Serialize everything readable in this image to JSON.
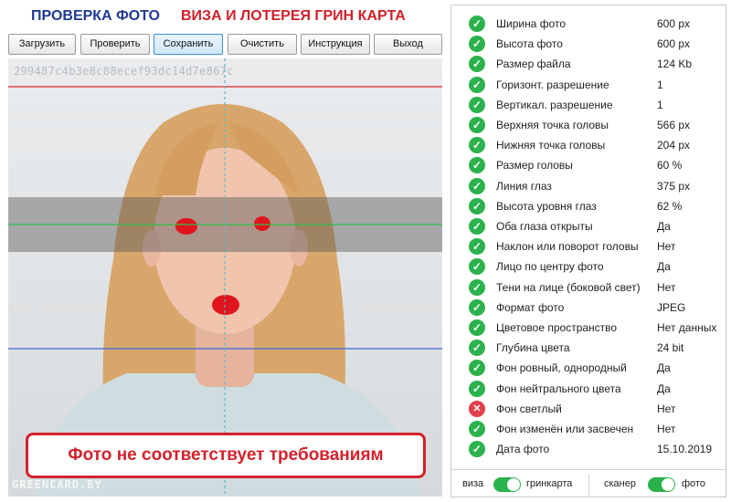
{
  "header": {
    "title_left": "ПРОВЕРКА ФОТО",
    "title_right": "ВИЗА И ЛОТЕРЕЯ ГРИН КАРТА"
  },
  "toolbar": {
    "buttons": [
      {
        "label": "Загрузить"
      },
      {
        "label": "Проверить"
      },
      {
        "label": "Сохранить",
        "active": true
      },
      {
        "label": "Очистить"
      },
      {
        "label": "Инструкция"
      },
      {
        "label": "Выход"
      }
    ]
  },
  "photo": {
    "hash": "299487c4b3e8c88ecef93dc14d7e867c",
    "watermark": "GREENCARD.BY",
    "warning": "Фото не соответствует требованиям"
  },
  "checks": [
    {
      "label": "Ширина фото",
      "value": "600 px",
      "status": "ok"
    },
    {
      "label": "Высота фото",
      "value": "600 px",
      "status": "ok"
    },
    {
      "label": "Размер файла",
      "value": "124 Kb",
      "status": "ok"
    },
    {
      "label": "Горизонт. разрешение",
      "value": "1",
      "status": "ok"
    },
    {
      "label": "Вертикал. разрешение",
      "value": "1",
      "status": "ok"
    },
    {
      "label": "Верхняя точка головы",
      "value": "566 px",
      "status": "ok"
    },
    {
      "label": "Нижняя точка головы",
      "value": "204 px",
      "status": "ok"
    },
    {
      "label": "Размер головы",
      "value": "60 %",
      "status": "ok"
    },
    {
      "label": "Линия глаз",
      "value": "375 px",
      "status": "ok"
    },
    {
      "label": "Высота уровня глаз",
      "value": "62 %",
      "status": "ok"
    },
    {
      "label": "Оба глаза открыты",
      "value": "Да",
      "status": "ok"
    },
    {
      "label": "Наклон или поворот головы",
      "value": "Нет",
      "status": "ok"
    },
    {
      "label": "Лицо по центру фото",
      "value": "Да",
      "status": "ok"
    },
    {
      "label": "Тени на лице (боковой свет)",
      "value": "Нет",
      "status": "ok"
    },
    {
      "label": "Формат фото",
      "value": "JPEG",
      "status": "ok"
    },
    {
      "label": "Цветовое пространство",
      "value": "Нет данных",
      "status": "ok"
    },
    {
      "label": "Глубина цвета",
      "value": "24 bit",
      "status": "ok"
    },
    {
      "label": "Фон ровный, однородный",
      "value": "Да",
      "status": "ok"
    },
    {
      "label": "Фон нейтрального цвета",
      "value": "Да",
      "status": "ok"
    },
    {
      "label": "Фон светлый",
      "value": "Нет",
      "status": "fail"
    },
    {
      "label": "Фон изменён или засвечен",
      "value": "Нет",
      "status": "ok"
    },
    {
      "label": "Дата фото",
      "value": "15.10.2019",
      "status": "ok"
    }
  ],
  "footer": {
    "mode_left_a": "виза",
    "mode_left_b": "гринкарта",
    "mode_right_a": "сканер",
    "mode_right_b": "фото"
  },
  "colors": {
    "ok": "#2bb24c",
    "fail": "#e0414a",
    "accent_red": "#d3222b",
    "accent_blue": "#1f3a93"
  }
}
